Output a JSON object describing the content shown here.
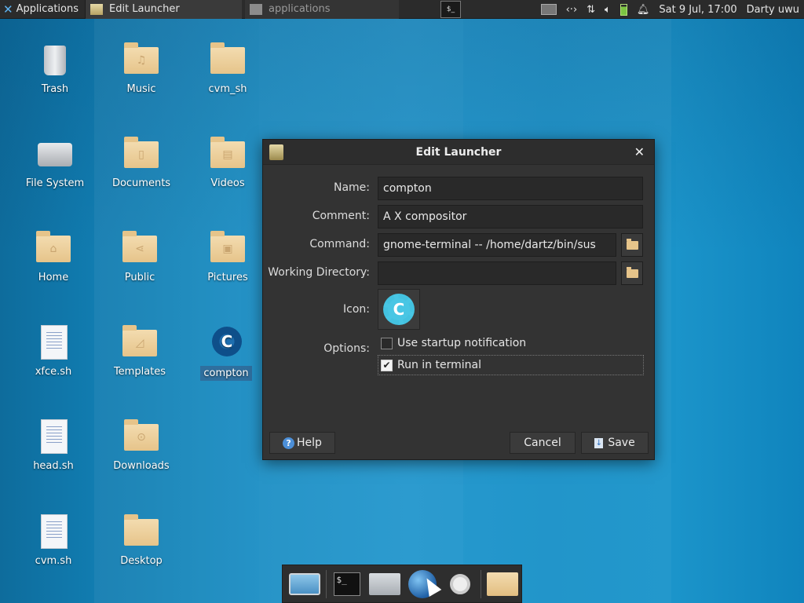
{
  "panel": {
    "applications_label": "Applications",
    "tasks": [
      {
        "label": "Edit Launcher",
        "active": true
      },
      {
        "label": "applications",
        "active": false
      }
    ],
    "clock": "Sat  9 Jul, 17:00",
    "user": "Darty uwu"
  },
  "desktop": {
    "icons": [
      {
        "label": "Trash",
        "icon": "trash-icon"
      },
      {
        "label": "Music",
        "icon": "music-folder-icon"
      },
      {
        "label": "cvm_sh",
        "icon": "folder-icon"
      },
      {
        "label": "File System",
        "icon": "drive-icon"
      },
      {
        "label": "Documents",
        "icon": "documents-folder-icon"
      },
      {
        "label": "Videos",
        "icon": "videos-folder-icon"
      },
      {
        "label": "Home",
        "icon": "home-folder-icon"
      },
      {
        "label": "Public",
        "icon": "public-folder-icon"
      },
      {
        "label": "Pictures",
        "icon": "pictures-folder-icon"
      },
      {
        "label": "xfce.sh",
        "icon": "script-file-icon"
      },
      {
        "label": "Templates",
        "icon": "templates-folder-icon"
      },
      {
        "label": "compton",
        "icon": "compton-gear-icon"
      },
      {
        "label": "head.sh",
        "icon": "script-file-icon"
      },
      {
        "label": "Downloads",
        "icon": "downloads-folder-icon"
      },
      {
        "label": "cvm.sh",
        "icon": "script-file-icon"
      },
      {
        "label": "Desktop",
        "icon": "folder-icon"
      }
    ]
  },
  "dialog": {
    "title": "Edit Launcher",
    "fields": {
      "name_label": "Name:",
      "name_value": "compton",
      "comment_label": "Comment:",
      "comment_value": "A X compositor",
      "command_label": "Command:",
      "command_value": "gnome-terminal -- /home/dartz/bin/sus",
      "workdir_label": "Working Directory:",
      "workdir_value": "",
      "icon_label": "Icon:",
      "icon_glyph": "C",
      "options_label": "Options:"
    },
    "options": [
      {
        "label": "Use startup notification",
        "checked": false
      },
      {
        "label": "Run in terminal",
        "checked": true
      }
    ],
    "buttons": {
      "help": "Help",
      "cancel": "Cancel",
      "save": "Save"
    }
  },
  "dock": {
    "items": [
      "desktop-icon",
      "terminal-icon",
      "home-icon",
      "web-browser-icon",
      "search-icon",
      "file-manager-icon"
    ],
    "terminal_glyph": "$_"
  },
  "colors": {
    "panel_bg": "#2b2b2b",
    "dialog_bg": "#333333",
    "desktop_accent": "#1a8ec4",
    "folder": "#e6c48a"
  }
}
